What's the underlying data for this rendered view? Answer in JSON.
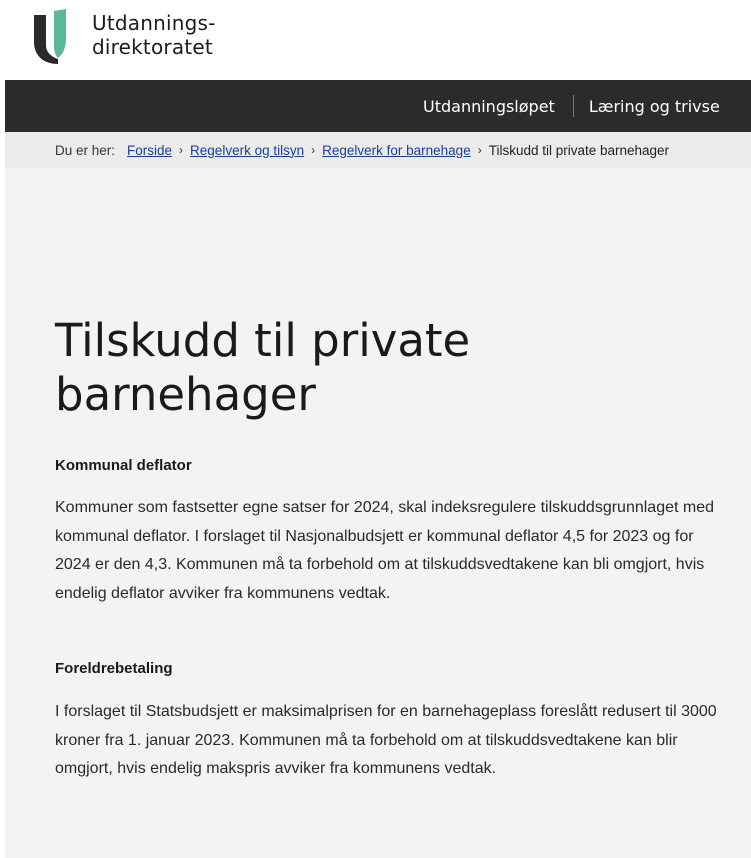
{
  "logo": {
    "line1": "Utdannings-",
    "line2": "direktoratet",
    "colors": {
      "dark": "#2a2a2a",
      "teal": "#5ab79a"
    }
  },
  "nav": {
    "items": [
      "Utdanningsløpet",
      "Læring og trivse"
    ]
  },
  "breadcrumb": {
    "prefix": "Du er her:",
    "links": [
      "Forside",
      "Regelverk og tilsyn",
      "Regelverk for barnehage"
    ],
    "current": "Tilskudd til private barnehager",
    "separator": "›"
  },
  "page": {
    "title_line1": "Tilskudd til private",
    "title_line2": "barnehager",
    "sections": [
      {
        "heading": "Kommunal deflator",
        "text": "Kommuner som fastsetter egne satser for 2024, skal indeksregulere tilskuddsgrunnlaget med kommunal deflator. I forslaget til Nasjonalbudsjett er kommunal deflator 4,5 for 2023 og for 2024 er den 4,3. Kommunen må ta forbehold om at tilskuddsvedtakene kan bli omgjort, hvis endelig deflator avviker fra kommunens vedtak."
      },
      {
        "heading": "Foreldrebetaling",
        "text": "I forslaget til Statsbudsjett er maksimalprisen for en barnehageplass foreslått redusert til 3000 kroner fra 1. januar 2023. Kommunen må ta forbehold om at tilskuddsvedtakene kan blir omgjort, hvis endelig makspris avviker fra kommunens vedtak."
      }
    ]
  }
}
